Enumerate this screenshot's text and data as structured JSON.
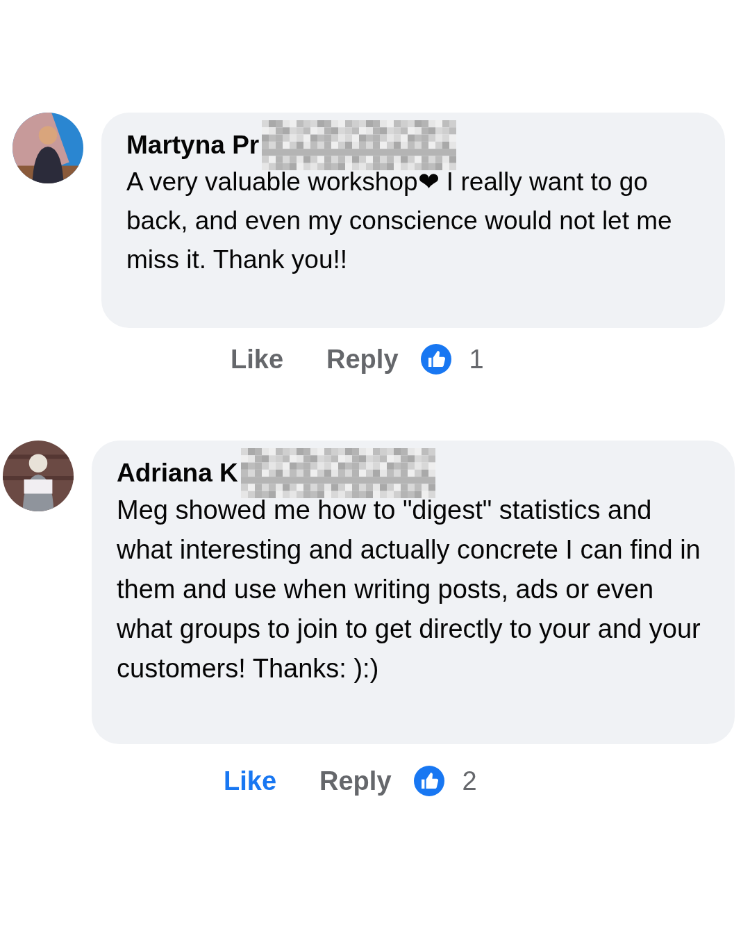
{
  "comments": [
    {
      "author": "Martyna Pr",
      "text": "A very valuable workshop❤ I really want to go back, and even my conscience would not let me miss it. Thank you!!",
      "liked": false,
      "actions": [
        "Like",
        "Reply"
      ],
      "reaction_count": "1"
    },
    {
      "author": "Adriana K",
      "text": "Meg showed me how to \"digest\" statistics and what interesting and actually concrete I can find in them and use when writing posts, ads or even what groups to join to get directly to your and your customers! Thanks: ):)",
      "liked": true,
      "actions": [
        "Like",
        "Reply"
      ],
      "reaction_count": "2"
    }
  ]
}
